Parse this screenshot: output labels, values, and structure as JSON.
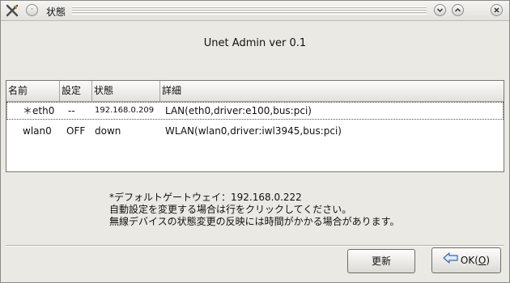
{
  "window": {
    "title": "状態"
  },
  "header": {
    "app_title": "Unet Admin ver 0.1"
  },
  "table": {
    "columns": [
      "名前",
      "設定",
      "状態",
      "詳細"
    ],
    "rows": [
      {
        "name": "＊eth0",
        "setting": "--",
        "status": "192.168.0.209",
        "detail": "LAN(eth0,driver:e100,bus:pci)"
      },
      {
        "name": "wlan0",
        "setting": "OFF",
        "status": "down",
        "detail": "WLAN(wlan0,driver:iwl3945,bus:pci)"
      }
    ]
  },
  "notes": {
    "line1": "*デフォルトゲートウェイ：192.168.0.222",
    "line2": "自動設定を変更する場合は行をクリックしてください。",
    "line3": "無線デバイスの状態変更の反映には時間がかかる場合があります。"
  },
  "buttons": {
    "refresh_label": "更新",
    "ok_label": "OK(",
    "ok_mnemonic": "O",
    "ok_close": ")"
  },
  "icons": {
    "app": "x-tools-icon",
    "menu": "window-menu-icon",
    "minimize": "minimize-icon",
    "maximize": "maximize-icon",
    "close": "close-icon",
    "ok": "arrow-left-icon"
  }
}
